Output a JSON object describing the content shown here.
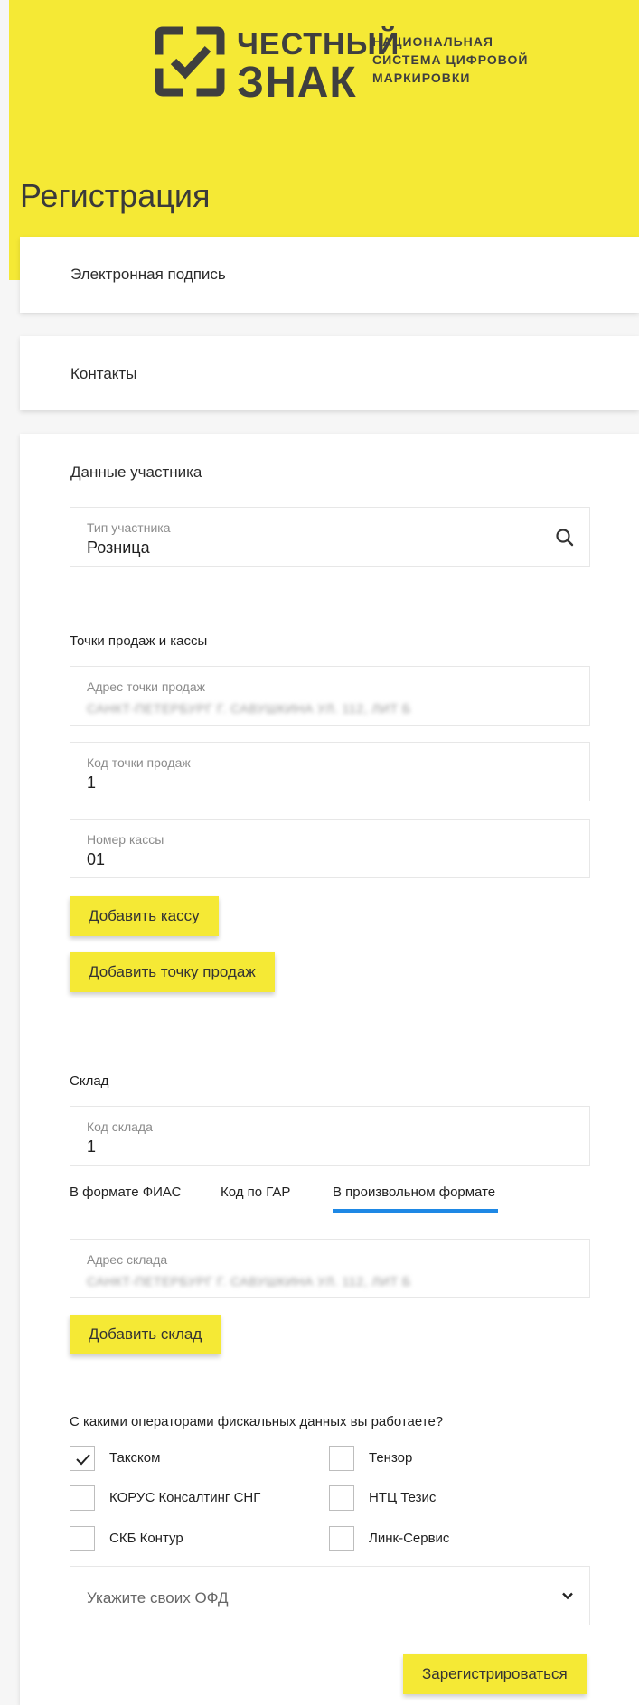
{
  "logo": {
    "line1": "ЧЕСТНЫЙ",
    "line2": "ЗНАК",
    "tagline1": "НАЦИОНАЛЬНАЯ",
    "tagline2": "СИСТЕМА ЦИФРОВОЙ",
    "tagline3": "МАРКИРОВКИ"
  },
  "page_title": "Регистрация",
  "sections": {
    "signature": "Электронная подпись",
    "contacts": "Контакты",
    "participant": "Данные участника"
  },
  "participant_type": {
    "label": "Тип участника",
    "value": "Розница",
    "icon": "search-icon"
  },
  "sales_points": {
    "heading": "Точки продаж и кассы",
    "address_label": "Адрес точки продаж",
    "address_value": "САНКТ-ПЕТЕРБУРГ Г. САВУШКИНА УЛ. 112, ЛИТ Б",
    "code_label": "Код точки продаж",
    "code_value": "1",
    "register_label": "Номер кассы",
    "register_value": "01",
    "add_register_button": "Добавить кассу",
    "add_point_button": "Добавить точку продаж"
  },
  "warehouse": {
    "heading": "Склад",
    "code_label": "Код склада",
    "code_value": "1",
    "tabs": [
      "В формате ФИАС",
      "Код по ГАР",
      "В произвольном формате"
    ],
    "active_tab": 2,
    "address_label": "Адрес склада",
    "address_value": "САНКТ-ПЕТЕРБУРГ Г. САВУШКИНА УЛ. 112, ЛИТ Б",
    "add_button": "Добавить склад"
  },
  "ofd": {
    "question": "С какими операторами фискальных данных вы работаете?",
    "options": [
      {
        "label": "Такском",
        "checked": true
      },
      {
        "label": "Тензор",
        "checked": false
      },
      {
        "label": "КОРУС Консалтинг СНГ",
        "checked": false
      },
      {
        "label": "НТЦ Тезис",
        "checked": false
      },
      {
        "label": "СКБ Контур",
        "checked": false
      },
      {
        "label": "Линк-Сервис",
        "checked": false
      }
    ],
    "select_placeholder": "Укажите своих ОФД",
    "select_icon": "chevron-down-icon"
  },
  "submit_button": "Зарегистрироваться",
  "colors": {
    "brand_yellow": "#f5e935",
    "tab_active": "#1e88e5",
    "background": "#f6f6f6"
  }
}
